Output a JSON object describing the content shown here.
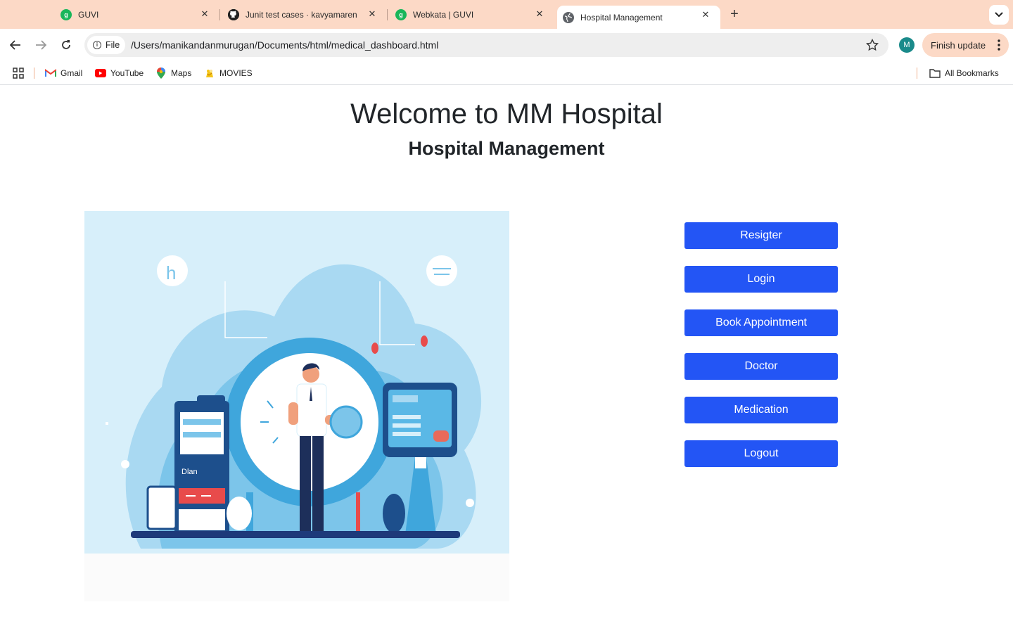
{
  "browser": {
    "tabs": [
      {
        "title": "GUVI",
        "icon": "guvi-icon",
        "active": false
      },
      {
        "title": "Junit test cases · kavyamaren",
        "icon": "github-icon",
        "active": false
      },
      {
        "title": "Webkata | GUVI",
        "icon": "guvi-icon",
        "active": false
      },
      {
        "title": "Hospital Management",
        "icon": "globe-icon",
        "active": true
      }
    ],
    "address": {
      "chip_label": "File",
      "url": "/Users/manikandanmurugan/Documents/html/medical_dashboard.html"
    },
    "profile_initial": "M",
    "finish_update_label": "Finish update",
    "bookmarks": [
      {
        "label": "Gmail",
        "icon": "gmail-icon"
      },
      {
        "label": "YouTube",
        "icon": "youtube-icon"
      },
      {
        "label": "Maps",
        "icon": "maps-icon"
      },
      {
        "label": "MOVIES",
        "icon": "movies-icon"
      }
    ],
    "all_bookmarks_label": "All Bookmarks",
    "colors": {
      "tabstrip": "#fcd9c6",
      "accent": "#2355f5"
    }
  },
  "page": {
    "heading": "Welcome to MM Hospital",
    "subheading": "Hospital Management",
    "illustration_icon": "hospital-illustration",
    "menu": [
      {
        "label": "Resigter"
      },
      {
        "label": "Login"
      },
      {
        "label": "Book Appointment"
      },
      {
        "label": "Doctor"
      },
      {
        "label": "Medication"
      },
      {
        "label": "Logout"
      }
    ]
  }
}
